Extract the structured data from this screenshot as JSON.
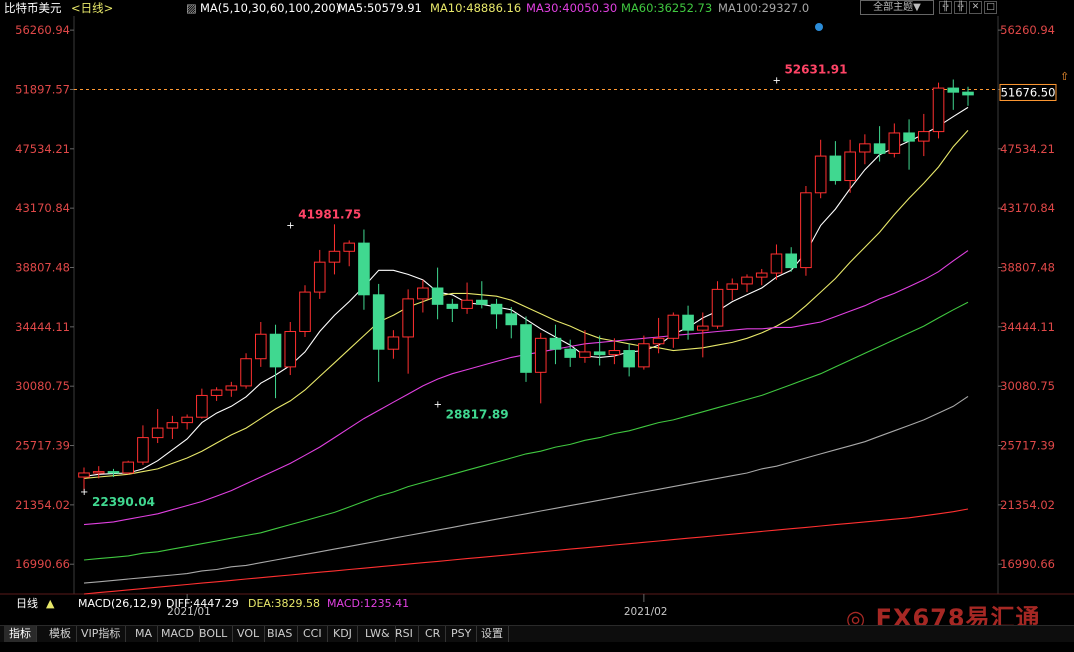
{
  "header": {
    "instrument": "比特币美元",
    "period": "<日线>",
    "ma_config": "MA(5,10,30,60,100,200)",
    "ma_values": [
      {
        "label": "MA5:50579.91",
        "color": "#ffffff"
      },
      {
        "label": "MA10:48886.16",
        "color": "#e8e86a"
      },
      {
        "label": "MA30:40050.30",
        "color": "#e040e0"
      },
      {
        "label": "MA60:36252.73",
        "color": "#40c840"
      },
      {
        "label": "MA100:29327.0",
        "color": "#a8a8a8"
      }
    ],
    "theme_button": "全部主题▼",
    "tool_icons": [
      "╬",
      "╬",
      "✕",
      "□",
      "⇧"
    ]
  },
  "footer": {
    "period_label": "日线",
    "period_arrow": "▲",
    "macd_label": "MACD(26,12,9)",
    "diff": "DIFF:4447.29",
    "dea": "DEA:3829.58",
    "macd": "MACD:1235.41",
    "watermark": "FX678易汇通",
    "tabs": [
      "指标",
      "模板",
      "VIP指标",
      "MA",
      "MACD",
      "BOLL",
      "VOL",
      "BIAS",
      "CCI",
      "KDJ",
      "LW&",
      "RSI",
      "CR",
      "PSY",
      "设置"
    ]
  },
  "colors": {
    "up": "#ff3030",
    "down": "#40d890",
    "price_line": "#ff9933",
    "high_label": "#ff4466",
    "low_label": "#40d890",
    "axis_text": "#e04848"
  },
  "chart_data": {
    "type": "candlestick",
    "y_ticks": [
      "56260.94",
      "51897.57",
      "47534.21",
      "43170.84",
      "38807.48",
      "34444.11",
      "30080.75",
      "25717.39",
      "21354.02",
      "16990.66"
    ],
    "ylim": [
      14800,
      57300
    ],
    "x_labels": [
      {
        "label": "2021/01",
        "index": 7
      },
      {
        "label": "2021/02",
        "index": 38
      }
    ],
    "current_price": "51676.50",
    "ref_price": 51897.57,
    "annotations": [
      {
        "label": "41981.75",
        "index": 14,
        "value": 41981.75,
        "kind": "high"
      },
      {
        "label": "28817.89",
        "index": 24,
        "value": 28817.89,
        "kind": "low"
      },
      {
        "label": "22390.04",
        "index": 0,
        "value": 22390.04,
        "kind": "low"
      },
      {
        "label": "52631.91",
        "index": 47,
        "value": 52631.91,
        "kind": "high"
      }
    ],
    "candles": [
      [
        23400,
        24100,
        22390,
        23700
      ],
      [
        23700,
        24200,
        23300,
        23800
      ],
      [
        23800,
        24000,
        23400,
        23700
      ],
      [
        23700,
        24600,
        23600,
        24500
      ],
      [
        24500,
        27200,
        24300,
        26300
      ],
      [
        26300,
        28400,
        25900,
        27000
      ],
      [
        27000,
        27900,
        26200,
        27400
      ],
      [
        27400,
        28000,
        26900,
        27800
      ],
      [
        27800,
        29900,
        27700,
        29400
      ],
      [
        29400,
        30000,
        29000,
        29800
      ],
      [
        29800,
        30400,
        29300,
        30100
      ],
      [
        30100,
        32500,
        29900,
        32100
      ],
      [
        32100,
        34800,
        31500,
        33900
      ],
      [
        33900,
        34600,
        29200,
        31500
      ],
      [
        31500,
        34800,
        30900,
        34100
      ],
      [
        34100,
        37500,
        33700,
        37000
      ],
      [
        37000,
        40100,
        36500,
        39200
      ],
      [
        39200,
        41981.75,
        38300,
        40000
      ],
      [
        40000,
        40800,
        38900,
        40600
      ],
      [
        40600,
        41600,
        35700,
        36800
      ],
      [
        36800,
        37600,
        30400,
        32800
      ],
      [
        32800,
        34200,
        32100,
        33700
      ],
      [
        33700,
        37200,
        31000,
        36500
      ],
      [
        36500,
        37900,
        35500,
        37300
      ],
      [
        37300,
        38800,
        35000,
        36100
      ],
      [
        36100,
        36500,
        34800,
        35800
      ],
      [
        35800,
        37700,
        35400,
        36400
      ],
      [
        36400,
        37800,
        35800,
        36100
      ],
      [
        36100,
        36500,
        34300,
        35400
      ],
      [
        35400,
        35900,
        33600,
        34600
      ],
      [
        34600,
        35200,
        30400,
        31100
      ],
      [
        31100,
        34000,
        28817.89,
        33600
      ],
      [
        33600,
        34600,
        31700,
        32800
      ],
      [
        32800,
        33500,
        31500,
        32200
      ],
      [
        32200,
        34200,
        31800,
        32600
      ],
      [
        32600,
        33800,
        31600,
        32400
      ],
      [
        32400,
        33600,
        31700,
        32700
      ],
      [
        32700,
        33200,
        30800,
        31500
      ],
      [
        31500,
        33800,
        31300,
        33200
      ],
      [
        33200,
        35100,
        32500,
        33600
      ],
      [
        33600,
        35500,
        32900,
        35300
      ],
      [
        35300,
        36000,
        33500,
        34200
      ],
      [
        34200,
        35500,
        32200,
        34500
      ],
      [
        34500,
        37800,
        34300,
        37200
      ],
      [
        37200,
        38000,
        36400,
        37600
      ],
      [
        37600,
        38300,
        37000,
        38100
      ],
      [
        38100,
        38700,
        37500,
        38400
      ],
      [
        38400,
        40500,
        37900,
        39800
      ],
      [
        39800,
        40300,
        38500,
        38800
      ],
      [
        38800,
        44800,
        38200,
        44300
      ],
      [
        44300,
        48200,
        43900,
        47000
      ],
      [
        47000,
        48100,
        44900,
        45200
      ],
      [
        45200,
        48200,
        44300,
        47300
      ],
      [
        47300,
        48600,
        46400,
        47900
      ],
      [
        47900,
        49200,
        46600,
        47200
      ],
      [
        47200,
        49400,
        46900,
        48700
      ],
      [
        48700,
        49700,
        46000,
        48100
      ],
      [
        48100,
        50100,
        47000,
        48800
      ],
      [
        48800,
        52400,
        48300,
        52000
      ],
      [
        52000,
        52631.91,
        50400,
        51700
      ],
      [
        51700,
        52100,
        50700,
        51500
      ]
    ],
    "ma": [
      {
        "name": "MA5",
        "color": "#ffffff",
        "values": [
          23450,
          23600,
          23650,
          23700,
          24000,
          24600,
          25400,
          26200,
          27400,
          28100,
          28600,
          29300,
          30300,
          30900,
          31600,
          32600,
          34100,
          35300,
          36300,
          37400,
          38600,
          38600,
          38300,
          37900,
          37000,
          36800,
          36200,
          36100,
          35900,
          35700,
          35000,
          34300,
          33700,
          33100,
          32300,
          32200,
          32300,
          32600,
          32700,
          33100,
          33900,
          34400,
          35100,
          35600,
          36300,
          36800,
          37300,
          38100,
          38600,
          39900,
          41900,
          43100,
          44600,
          46000,
          47100,
          47600,
          48100,
          48600,
          49200,
          49900,
          50579.91
        ]
      },
      {
        "name": "MA10",
        "color": "#e8e86a",
        "values": [
          23300,
          23400,
          23500,
          23600,
          23800,
          24000,
          24400,
          24800,
          25300,
          25900,
          26500,
          27000,
          27700,
          28400,
          29000,
          29800,
          30800,
          31800,
          32800,
          33800,
          34800,
          35300,
          35900,
          36300,
          36700,
          36900,
          36900,
          36800,
          36700,
          36400,
          35900,
          35400,
          34900,
          34500,
          34000,
          33600,
          33400,
          33200,
          33000,
          32900,
          32700,
          32800,
          32900,
          33100,
          33300,
          33600,
          34000,
          34500,
          35100,
          36000,
          37000,
          38000,
          39200,
          40300,
          41400,
          42700,
          43900,
          45000,
          46200,
          47700,
          48886.16
        ]
      },
      {
        "name": "MA30",
        "color": "#e040e0",
        "values": [
          19900,
          20000,
          20100,
          20300,
          20500,
          20700,
          21000,
          21300,
          21600,
          22000,
          22400,
          22900,
          23400,
          23900,
          24400,
          25000,
          25600,
          26300,
          27000,
          27700,
          28300,
          28900,
          29500,
          30100,
          30600,
          31000,
          31300,
          31600,
          31900,
          32200,
          32400,
          32600,
          32800,
          33000,
          33200,
          33300,
          33400,
          33500,
          33600,
          33700,
          33800,
          33900,
          34000,
          34100,
          34200,
          34300,
          34300,
          34400,
          34400,
          34600,
          34800,
          35200,
          35600,
          36000,
          36500,
          36900,
          37400,
          37900,
          38500,
          39300,
          40050.3
        ]
      },
      {
        "name": "MA60",
        "color": "#40c840",
        "values": [
          17300,
          17400,
          17500,
          17600,
          17800,
          17900,
          18100,
          18300,
          18500,
          18700,
          18900,
          19100,
          19300,
          19600,
          19900,
          20200,
          20500,
          20800,
          21200,
          21600,
          22000,
          22300,
          22700,
          23000,
          23300,
          23600,
          23900,
          24200,
          24500,
          24800,
          25100,
          25300,
          25600,
          25800,
          26100,
          26300,
          26600,
          26800,
          27100,
          27400,
          27600,
          27900,
          28200,
          28500,
          28800,
          29100,
          29400,
          29800,
          30200,
          30600,
          31000,
          31500,
          32000,
          32500,
          33000,
          33500,
          34000,
          34500,
          35100,
          35700,
          36252.73
        ]
      },
      {
        "name": "MA100",
        "color": "#a8a8a8",
        "values": [
          15600,
          15700,
          15800,
          15900,
          16000,
          16100,
          16200,
          16300,
          16500,
          16600,
          16800,
          16900,
          17100,
          17300,
          17500,
          17700,
          17900,
          18100,
          18300,
          18500,
          18700,
          18900,
          19100,
          19300,
          19500,
          19700,
          19900,
          20100,
          20300,
          20500,
          20700,
          20900,
          21100,
          21300,
          21500,
          21700,
          21900,
          22100,
          22300,
          22500,
          22700,
          22900,
          23100,
          23300,
          23500,
          23700,
          24000,
          24200,
          24500,
          24800,
          25100,
          25400,
          25700,
          26000,
          26400,
          26800,
          27200,
          27600,
          28100,
          28600,
          29327.0
        ]
      },
      {
        "name": "MA200",
        "color": "#ff3030",
        "values": [
          14800,
          14900,
          15000,
          15100,
          15200,
          15300,
          15400,
          15500,
          15600,
          15700,
          15800,
          15900,
          16000,
          16100,
          16200,
          16300,
          16400,
          16500,
          16600,
          16700,
          16800,
          16900,
          17000,
          17100,
          17200,
          17300,
          17400,
          17500,
          17600,
          17700,
          17800,
          17900,
          18000,
          18100,
          18200,
          18300,
          18400,
          18500,
          18600,
          18700,
          18800,
          18900,
          19000,
          19100,
          19200,
          19300,
          19400,
          19500,
          19600,
          19700,
          19800,
          19900,
          20000,
          20100,
          20200,
          20300,
          20400,
          20550,
          20700,
          20850,
          21050
        ]
      }
    ]
  }
}
